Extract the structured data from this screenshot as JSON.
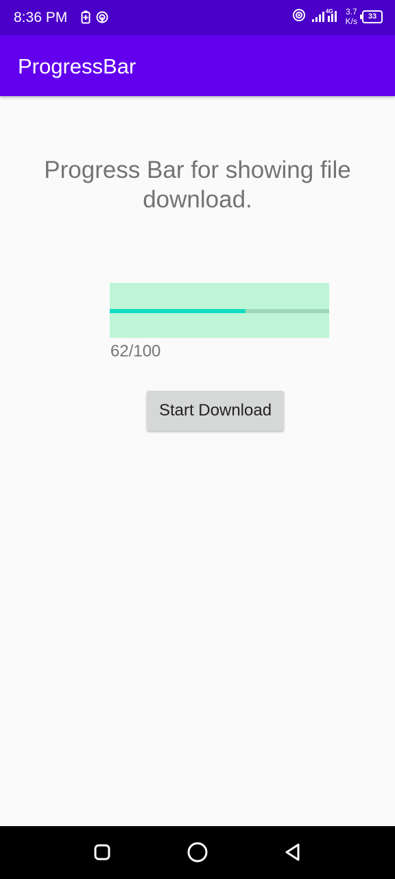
{
  "status_bar": {
    "time": "8:36 PM",
    "network_tag": "4G",
    "net_speed_value": "3.7",
    "net_speed_unit": "K/s",
    "battery_level": "33"
  },
  "app_bar": {
    "title": "ProgressBar"
  },
  "main": {
    "heading": "Progress Bar for showing file download.",
    "progress": {
      "value": 62,
      "max": 100,
      "label": "62/100"
    },
    "download_button_label": "Start Download"
  },
  "colors": {
    "status_bar": "#4a00c8",
    "app_bar": "#6200ee",
    "progress_background": "#bdf5d6",
    "progress_track": "#9ed8b8",
    "progress_fill": "#10dcc0",
    "button": "#d6d7d7"
  },
  "icons": {
    "status_left": [
      "battery-saver-icon",
      "hotspot-icon"
    ],
    "status_right": [
      "wifi-hotspot-icon",
      "signal-icon",
      "battery-icon"
    ],
    "navigation": [
      "recent-apps-icon",
      "home-icon",
      "back-icon"
    ]
  }
}
